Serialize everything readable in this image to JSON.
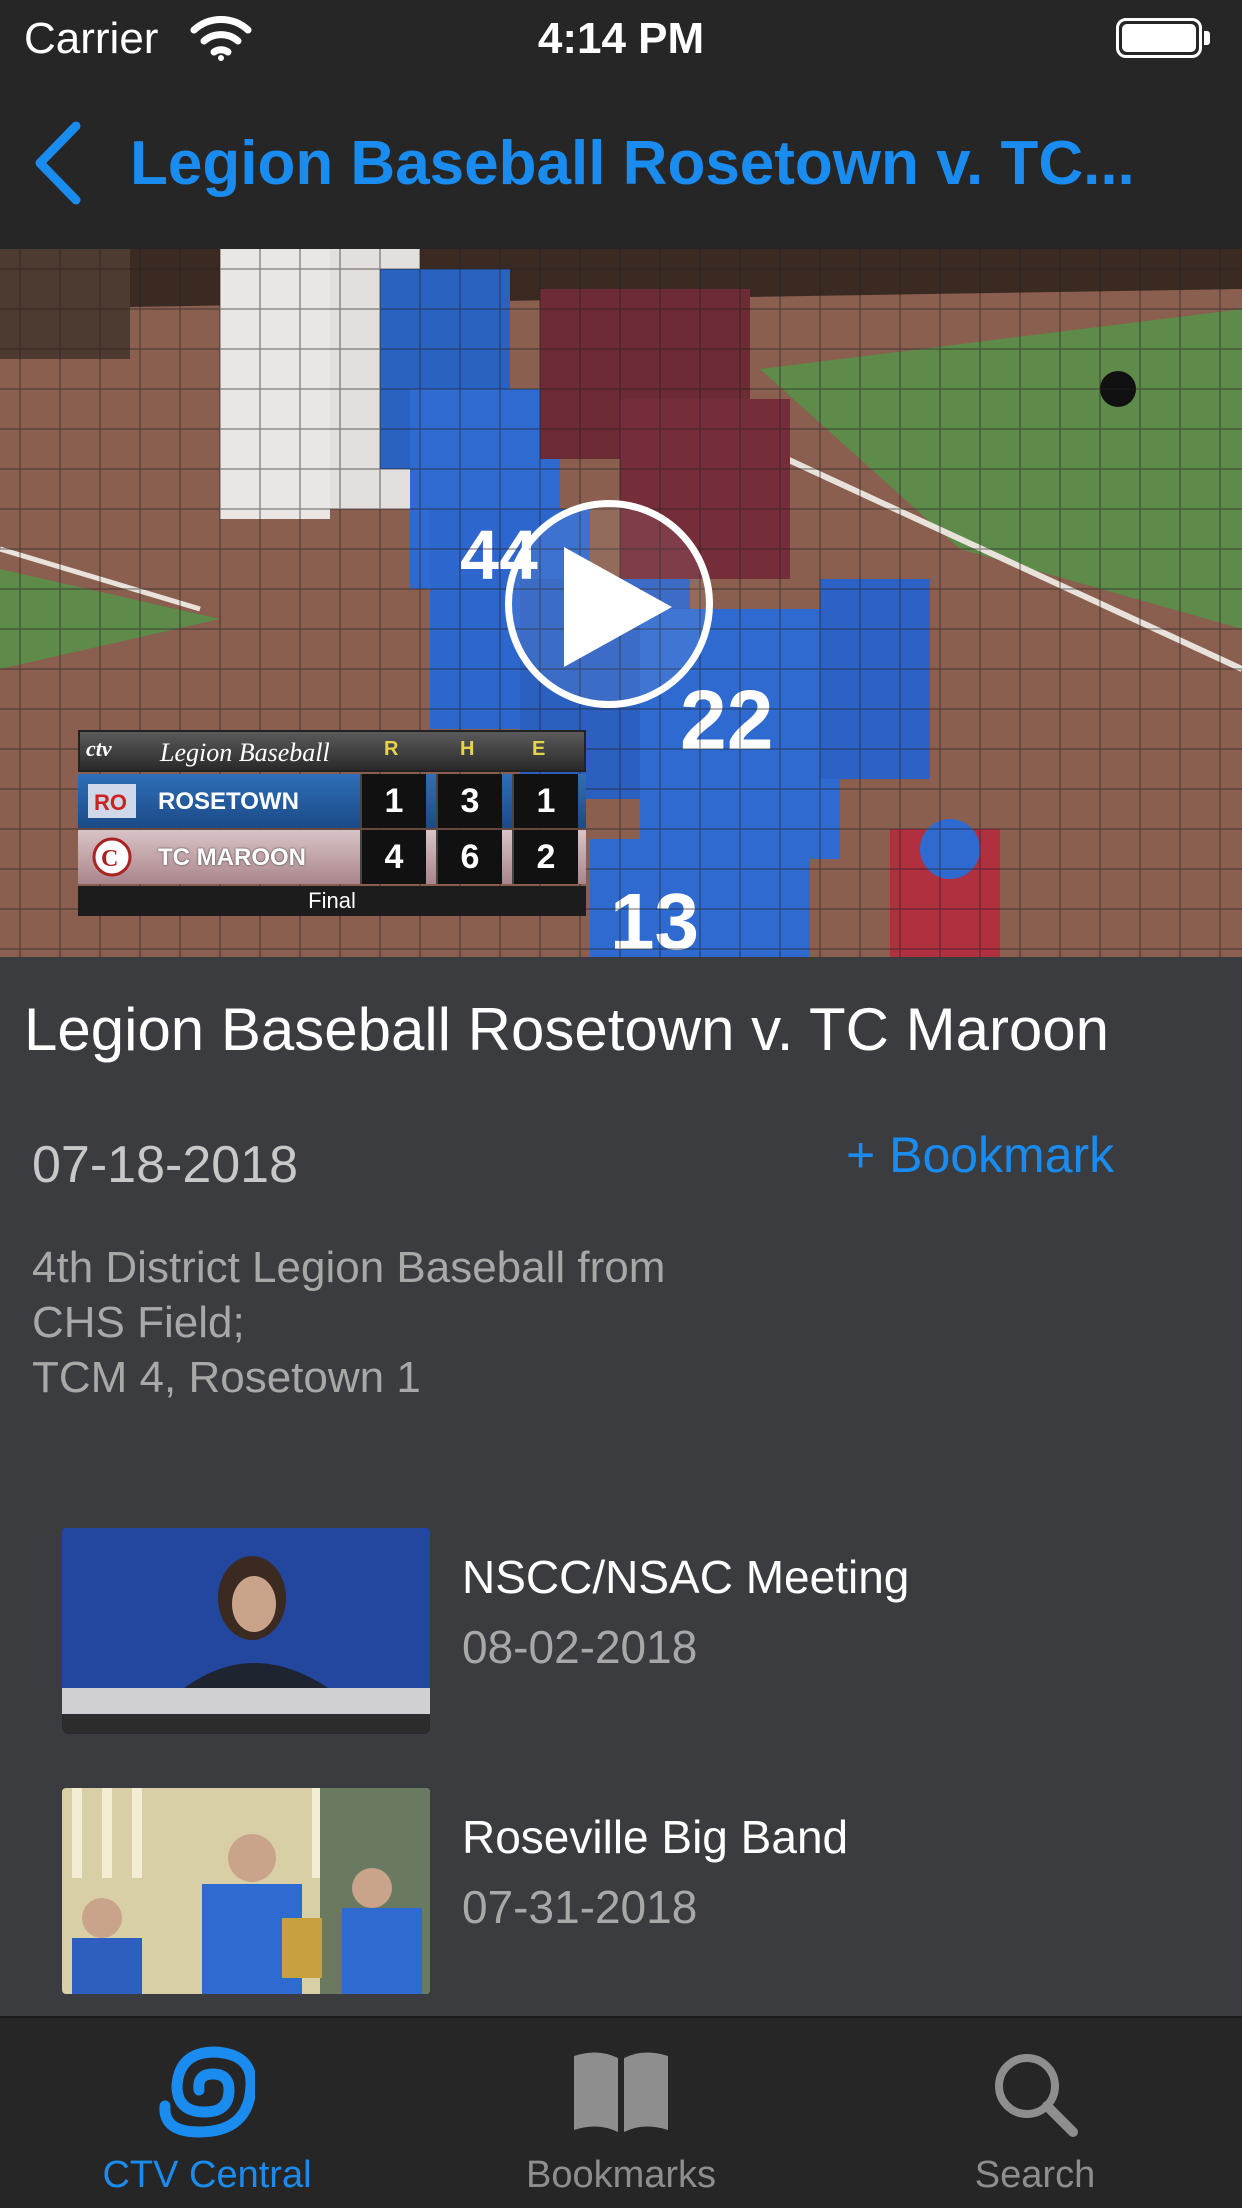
{
  "status_bar": {
    "carrier": "Carrier",
    "time": "4:14 PM"
  },
  "nav": {
    "title": "Legion Baseball Rosetown v. TC..."
  },
  "video": {
    "scoreboard": {
      "league": "Legion Baseball",
      "columns": [
        "R",
        "H",
        "E"
      ],
      "teams": [
        {
          "name": "ROSETOWN",
          "r": "1",
          "h": "3",
          "e": "1"
        },
        {
          "name": "TC MAROON",
          "r": "4",
          "h": "6",
          "e": "2"
        }
      ],
      "status": "Final"
    }
  },
  "detail": {
    "title": "Legion Baseball Rosetown v. TC Maroon",
    "date": "07-18-2018",
    "bookmark_label": "+ Bookmark",
    "description": "4th District Legion Baseball from\nCHS Field;\nTCM 4, Rosetown 1"
  },
  "related": [
    {
      "title": "NSCC/NSAC Meeting",
      "date": "08-02-2018"
    },
    {
      "title": "Roseville Big Band",
      "date": "07-31-2018"
    }
  ],
  "tabs": [
    {
      "label": "CTV Central",
      "icon": "ctv-swirl-icon",
      "active": true
    },
    {
      "label": "Bookmarks",
      "icon": "book-icon",
      "active": false
    },
    {
      "label": "Search",
      "icon": "search-icon",
      "active": false
    }
  ],
  "colors": {
    "accent": "#1a8cf0",
    "bar": "#262626",
    "background": "#3b3c3f"
  }
}
